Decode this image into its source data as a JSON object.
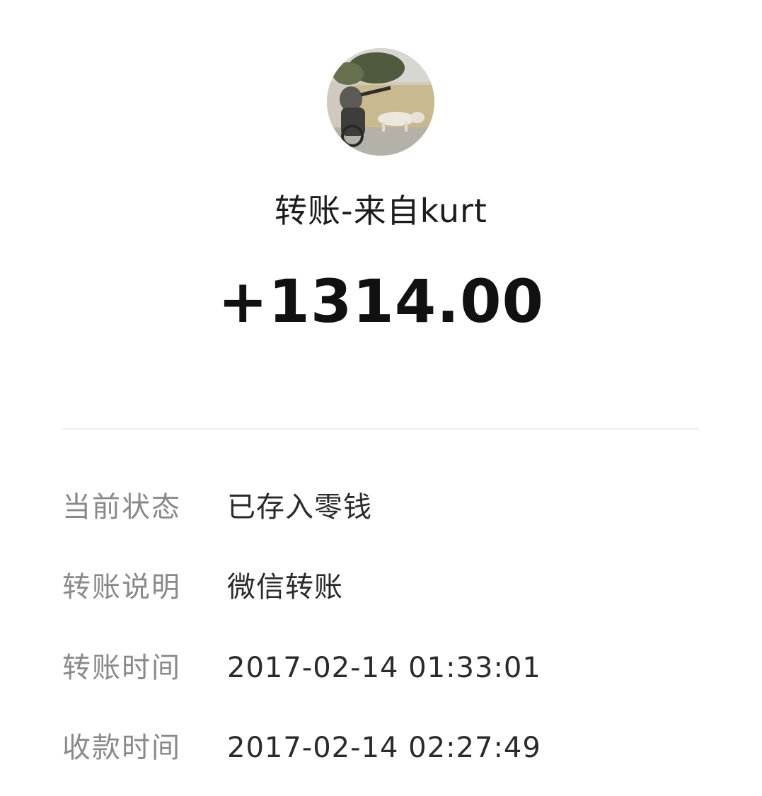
{
  "transfer": {
    "sender_title": "转账-来自kurt",
    "amount": "+1314.00"
  },
  "avatar": {
    "icon": "avatar-photo-icon"
  },
  "details": [
    {
      "label": "当前状态",
      "value": "已存入零钱"
    },
    {
      "label": "转账说明",
      "value": "微信转账"
    },
    {
      "label": "转账时间",
      "value": "2017-02-14 01:33:01"
    },
    {
      "label": "收款时间",
      "value": "2017-02-14 02:27:49"
    }
  ],
  "colors": {
    "background": "#ffffff",
    "label_text": "#8a8a8a",
    "value_text": "#2a2a2a",
    "amount_text": "#111111",
    "divider": "#ececec"
  }
}
